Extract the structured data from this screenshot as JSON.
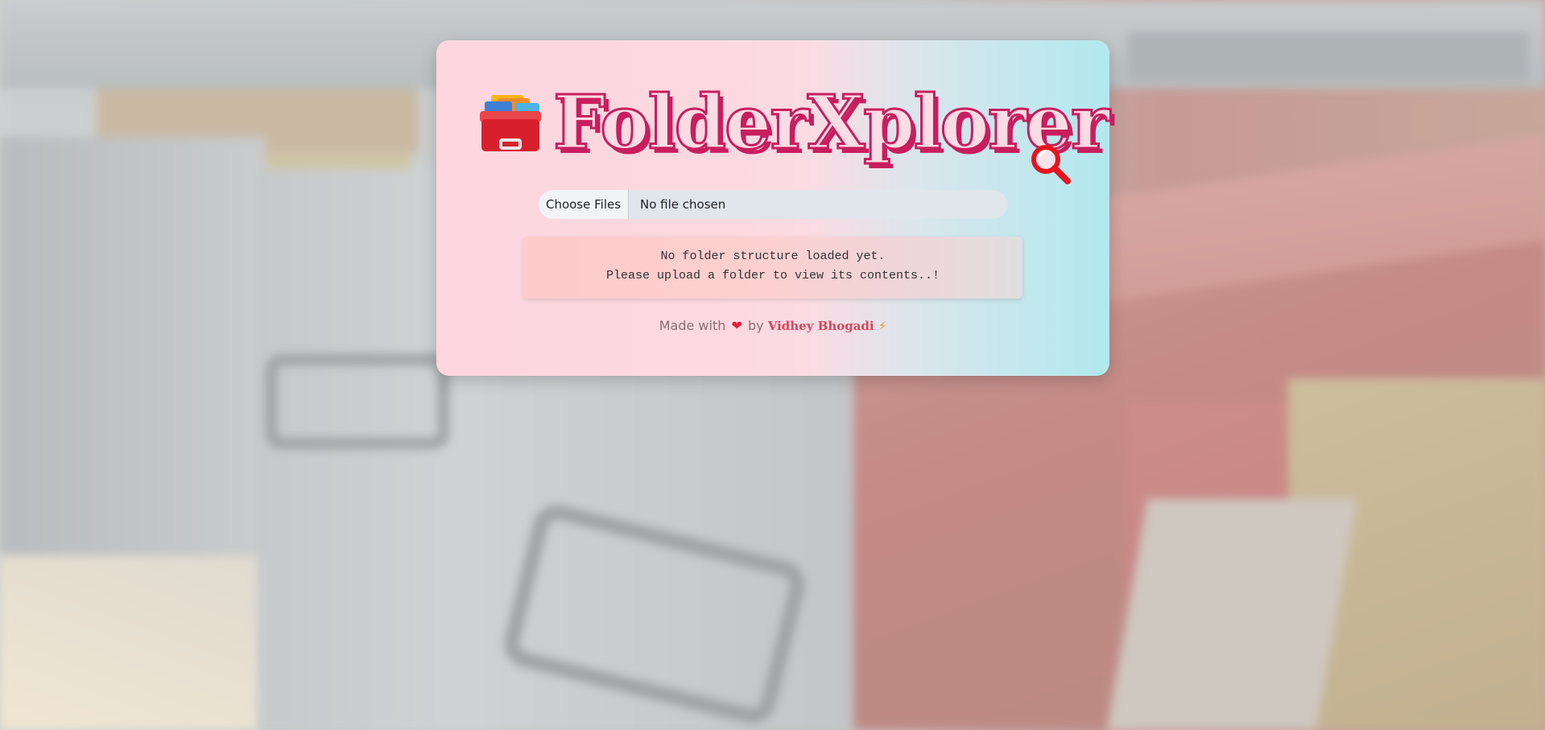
{
  "app": {
    "title": "FolderXplorer"
  },
  "icons": {
    "logo": "card-file-box-icon",
    "search": "magnifying-glass-icon",
    "heart": "red-heart-icon",
    "bolt": "lightning-icon"
  },
  "upload": {
    "button_label": "Choose Files",
    "status_text": "No file chosen"
  },
  "status": {
    "line1": "No folder structure loaded yet.",
    "line2": "Please upload a folder to view its contents..!"
  },
  "footer": {
    "made_with": "Made with",
    "heart": "❤",
    "by": "by",
    "author": "Vidhey Bhogadi",
    "bolt": "⚡"
  },
  "colors": {
    "brand": "#c81e5e",
    "author": "#d9455b",
    "status_bg": "#fecaca"
  }
}
